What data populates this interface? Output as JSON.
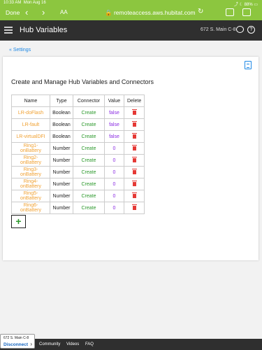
{
  "status_bar": {
    "time": "10:33 AM",
    "date": "Mon Aug 16",
    "battery": "88%"
  },
  "browser": {
    "done_label": "Done",
    "aa_label": "AA",
    "url": "remoteaccess.aws.hubitat.com"
  },
  "header": {
    "title": "Hub Variables",
    "hub_name": "672 S. Main C-8"
  },
  "breadcrumb": {
    "label": "« Settings"
  },
  "card": {
    "heading": "Create and Manage Hub Variables and Connectors",
    "columns": [
      "Name",
      "Type",
      "Connector",
      "Value",
      "Delete"
    ],
    "rows": [
      {
        "name": "LR-doFlash",
        "type": "Boolean",
        "connector": "Create",
        "value": "false"
      },
      {
        "name": "LR-fault",
        "type": "Boolean",
        "connector": "Create",
        "value": "false"
      },
      {
        "name": "LR-virtualDFI",
        "type": "Boolean",
        "connector": "Create",
        "value": "false"
      },
      {
        "name": "Ring1-onBattery",
        "type": "Number",
        "connector": "Create",
        "value": "0"
      },
      {
        "name": "Ring2-onBattery",
        "type": "Number",
        "connector": "Create",
        "value": "0"
      },
      {
        "name": "Ring3-onBattery",
        "type": "Number",
        "connector": "Create",
        "value": "0"
      },
      {
        "name": "Ring4-onBattery",
        "type": "Number",
        "connector": "Create",
        "value": "0"
      },
      {
        "name": "Ring5-onBattery",
        "type": "Number",
        "connector": "Create",
        "value": "0"
      },
      {
        "name": "Ring6-onBattery",
        "type": "Number",
        "connector": "Create",
        "value": "0"
      }
    ],
    "add_label": "+"
  },
  "footer": {
    "hub_name": "672 S. Main C-8",
    "disconnect_label": "Disconnect",
    "links": [
      "Community",
      "Videos",
      "FAQ"
    ]
  }
}
